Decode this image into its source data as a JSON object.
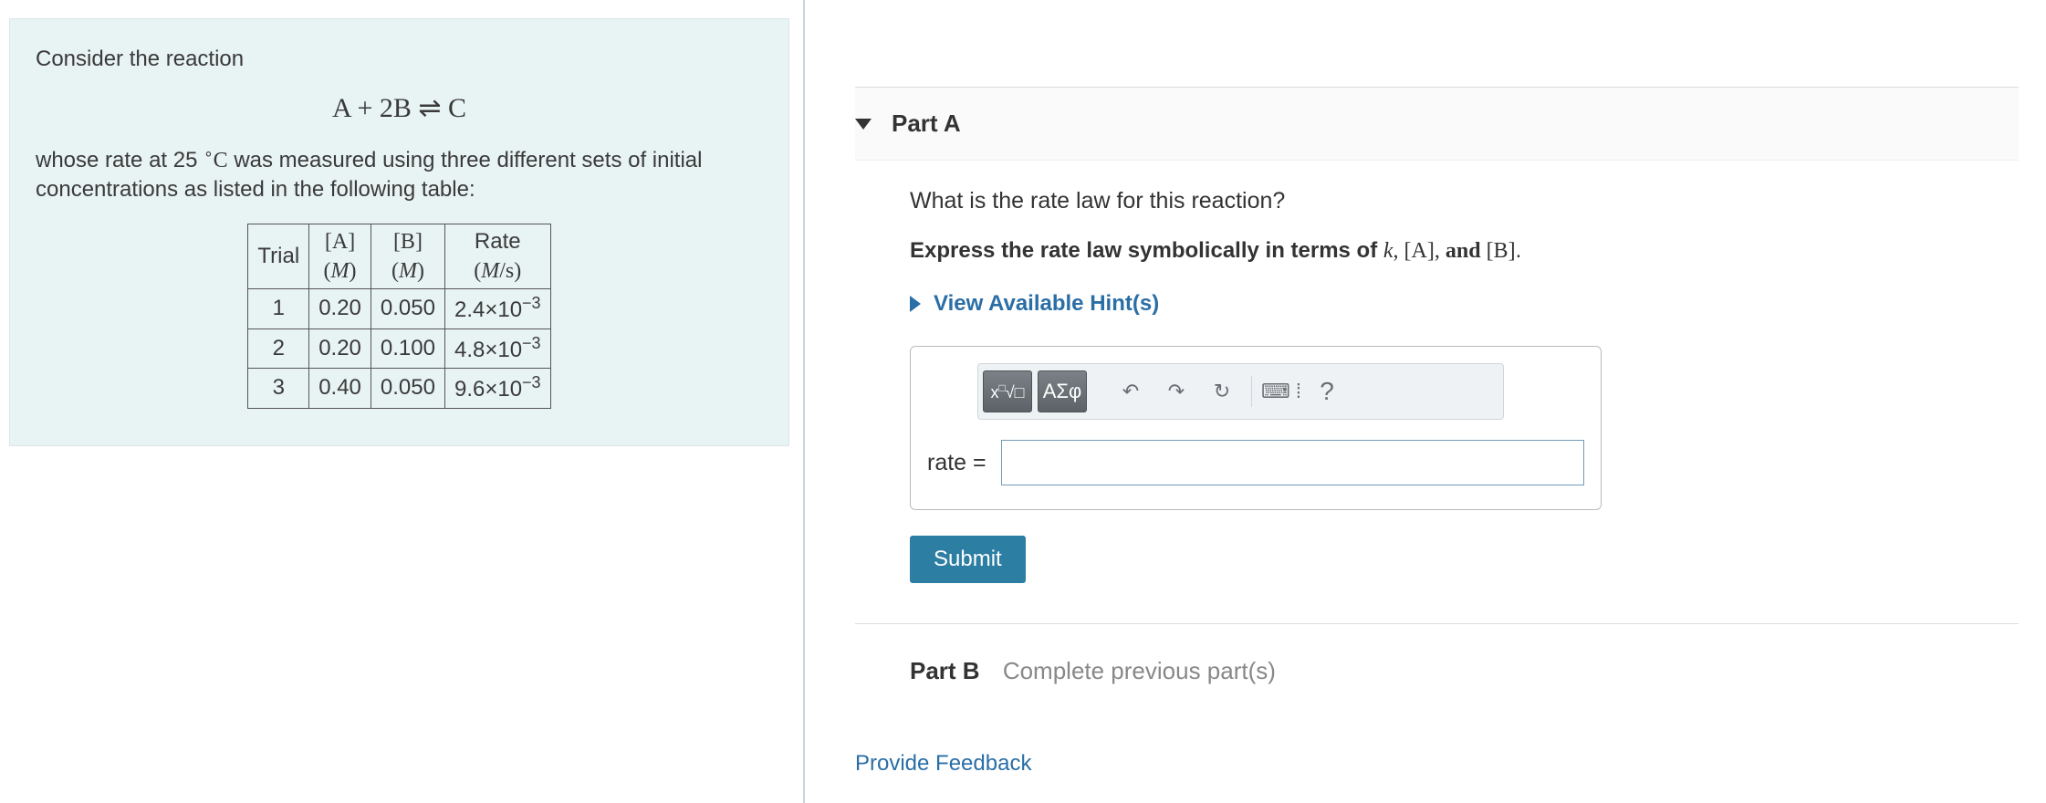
{
  "left": {
    "intro1": "Consider the reaction",
    "equation_html": "A + 2B ⇌ C",
    "intro2_pre": "whose rate at 25 ",
    "intro2_temp": "°C",
    "intro2_post": " was measured using three different sets of initial concentrations as listed in the following table:",
    "table": {
      "headers": {
        "trial": "Trial",
        "A_top": "[A]",
        "A_bot": "(M)",
        "B_top": "[B]",
        "B_bot": "(M)",
        "rate_top": "Rate",
        "rate_bot": "(M/s)"
      },
      "rows": [
        {
          "trial": "1",
          "A": "0.20",
          "B": "0.050",
          "rate_m": "2.4×10",
          "rate_e": "−3"
        },
        {
          "trial": "2",
          "A": "0.20",
          "B": "0.100",
          "rate_m": "4.8×10",
          "rate_e": "−3"
        },
        {
          "trial": "3",
          "A": "0.40",
          "B": "0.050",
          "rate_m": "9.6×10",
          "rate_e": "−3"
        }
      ]
    }
  },
  "right": {
    "partA": {
      "label": "Part A",
      "question": "What is the rate law for this reaction?",
      "instruction_pre": "Express the rate law symbolically in terms of ",
      "instruction_vars": "k, [A], and [B].",
      "hints_label": "View Available Hint(s)",
      "toolbar": {
        "templates": "▭√▭",
        "greek": "ΑΣφ",
        "undo": "↶",
        "redo": "↷",
        "reset": "↻",
        "keyboard": "⌨ ⁞",
        "help": "?"
      },
      "answer_prefix": "rate =",
      "answer_value": "",
      "submit": "Submit"
    },
    "partB": {
      "label": "Part B",
      "status": "Complete previous part(s)"
    },
    "feedback": "Provide Feedback"
  }
}
